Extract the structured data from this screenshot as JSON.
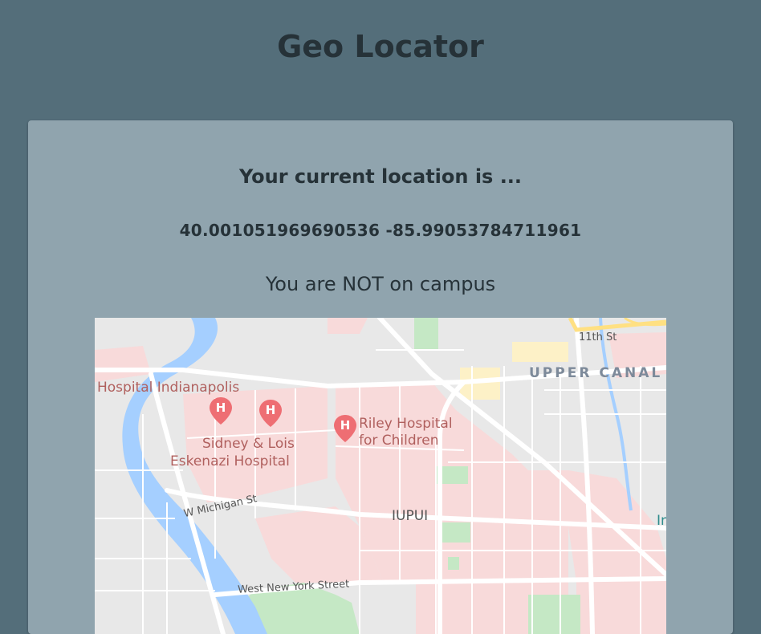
{
  "header": {
    "title": "Geo Locator"
  },
  "card": {
    "heading": "Your current location is ...",
    "latitude": "40.001051969690536",
    "longitude": "-85.99053784711961",
    "status": "You are NOT on campus"
  },
  "map": {
    "labels": {
      "hospital_indianapolis": "Hospital Indianapolis",
      "riley_line1": "Riley Hospital",
      "riley_line2": "for Children",
      "sidney_line1": "Sidney & Lois",
      "sidney_line2": "Eskenazi Hospital",
      "w_michigan": "W Michigan St",
      "iupui": "IUPUI",
      "west_new_york": "West New York Street",
      "eleventh_st": "11th St",
      "upper_canal": "UPPER CANAL",
      "edge_text": "In W"
    },
    "colors": {
      "river": "#a5cfff",
      "campus": "#f8dada",
      "park": "#c5e8c5",
      "road": "#ffffff",
      "highway": "#ffe082",
      "pin": "#ee6e73"
    },
    "icons": [
      "hospital-pin-icon",
      "hospital-pin-icon",
      "hospital-pin-icon"
    ]
  }
}
